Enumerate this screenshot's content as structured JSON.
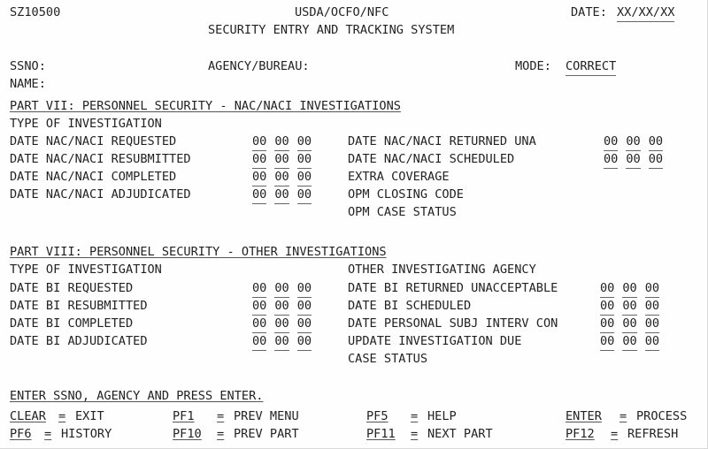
{
  "screen": {
    "program_id": "SZ10500",
    "org_line": "USDA/OCFO/NFC",
    "title": "SECURITY ENTRY AND TRACKING SYSTEM",
    "date_label": "DATE:",
    "date_value": "XX/XX/XX"
  },
  "identity": {
    "ssno_label": "SSNO:",
    "ssno_value": "",
    "name_label": "NAME:",
    "name_value": "",
    "agency_label": "AGENCY/BUREAU:",
    "agency_value": "",
    "mode_label": "MODE:",
    "mode_value": "CORRECT"
  },
  "part7": {
    "heading": "PART VII: PERSONNEL SECURITY - NAC/NACI INVESTIGATIONS",
    "left_rows": [
      {
        "label": "TYPE OF INVESTIGATION",
        "has_date": false,
        "value": ""
      },
      {
        "label": "DATE NAC/NACI REQUESTED",
        "has_date": true,
        "mm": "00",
        "dd": "00",
        "yy": "00"
      },
      {
        "label": "DATE NAC/NACI RESUBMITTED",
        "has_date": true,
        "mm": "00",
        "dd": "00",
        "yy": "00"
      },
      {
        "label": "DATE NAC/NACI COMPLETED",
        "has_date": true,
        "mm": "00",
        "dd": "00",
        "yy": "00"
      },
      {
        "label": "DATE NAC/NACI ADJUDICATED",
        "has_date": true,
        "mm": "00",
        "dd": "00",
        "yy": "00"
      }
    ],
    "right_rows": [
      {
        "label": "",
        "has_date": false
      },
      {
        "label": "DATE NAC/NACI RETURNED UNA",
        "has_date": true,
        "mm": "00",
        "dd": "00",
        "yy": "00"
      },
      {
        "label": "DATE NAC/NACI SCHEDULED",
        "has_date": true,
        "mm": "00",
        "dd": "00",
        "yy": "00"
      },
      {
        "label": "EXTRA COVERAGE",
        "has_date": false
      },
      {
        "label": "OPM CLOSING CODE",
        "has_date": false
      },
      {
        "label": "OPM CASE STATUS",
        "has_date": false
      }
    ]
  },
  "part8": {
    "heading": "PART VIII: PERSONNEL SECURITY - OTHER INVESTIGATIONS",
    "left_rows": [
      {
        "label": "TYPE OF INVESTIGATION",
        "has_date": false
      },
      {
        "label": "DATE BI REQUESTED",
        "has_date": true,
        "mm": "00",
        "dd": "00",
        "yy": "00"
      },
      {
        "label": "DATE BI RESUBMITTED",
        "has_date": true,
        "mm": "00",
        "dd": "00",
        "yy": "00"
      },
      {
        "label": "DATE BI COMPLETED",
        "has_date": true,
        "mm": "00",
        "dd": "00",
        "yy": "00"
      },
      {
        "label": "DATE BI ADJUDICATED",
        "has_date": true,
        "mm": "00",
        "dd": "00",
        "yy": "00"
      }
    ],
    "right_rows": [
      {
        "label": "OTHER INVESTIGATING AGENCY",
        "has_date": false
      },
      {
        "label": "DATE BI RETURNED UNACCEPTABLE",
        "has_date": true,
        "mm": "00",
        "dd": "00",
        "yy": "00"
      },
      {
        "label": "DATE BI SCHEDULED",
        "has_date": true,
        "mm": "00",
        "dd": "00",
        "yy": "00"
      },
      {
        "label": "DATE PERSONAL SUBJ INTERV CON",
        "has_date": true,
        "mm": "00",
        "dd": "00",
        "yy": "00"
      },
      {
        "label": "UPDATE INVESTIGATION DUE",
        "has_date": true,
        "mm": "00",
        "dd": "00",
        "yy": "00"
      },
      {
        "label": "CASE STATUS",
        "has_date": false
      }
    ]
  },
  "footer": {
    "instruction": "ENTER SSNO, AGENCY AND PRESS ENTER.",
    "keys": [
      {
        "key": "CLEAR",
        "eq": "=",
        "action": "EXIT"
      },
      {
        "key": "PF1",
        "eq": "=",
        "action": "PREV MENU"
      },
      {
        "key": "PF5",
        "eq": "=",
        "action": "HELP"
      },
      {
        "key": "ENTER",
        "eq": "=",
        "action": "PROCESS"
      },
      {
        "key": "PF6",
        "eq": "=",
        "action": "HISTORY"
      },
      {
        "key": "PF10",
        "eq": "=",
        "action": "PREV PART"
      },
      {
        "key": "PF11",
        "eq": "=",
        "action": "NEXT PART"
      },
      {
        "key": "PF12",
        "eq": "=",
        "action": "REFRESH"
      }
    ]
  },
  "colors": {
    "background": "#fefefe",
    "text": "#222222",
    "underline": "#666666"
  }
}
